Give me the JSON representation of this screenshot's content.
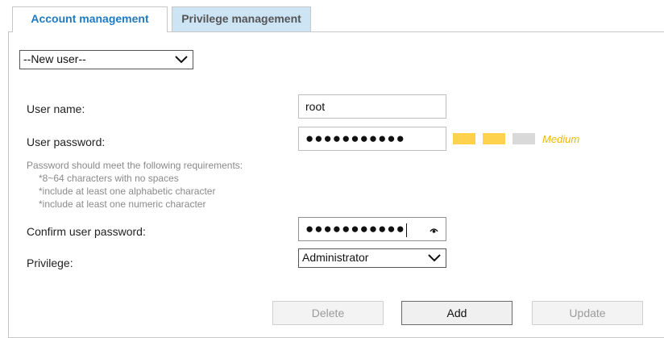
{
  "tabs": [
    {
      "label": "Account management",
      "active": true
    },
    {
      "label": "Privilege management",
      "active": false
    }
  ],
  "user_select": {
    "value": "--New user--"
  },
  "form": {
    "username_label": "User name:",
    "username_value": "root",
    "password_label": "User password:",
    "password_value": "●●●●●●●●●●●",
    "strength": {
      "level": 2,
      "max": 3,
      "text": "Medium",
      "color_on": "#ffd24d",
      "color_off": "#d9d9d9",
      "text_color": "#f2b705"
    },
    "requirements": [
      "Password should meet the following requirements:",
      "*8~64 characters with no spaces",
      "*include at least one alphabetic character",
      "*include at least one numeric character"
    ],
    "confirm_label": "Confirm user password:",
    "confirm_value": "●●●●●●●●●●●",
    "privilege_label": "Privilege:",
    "privilege_value": "Administrator"
  },
  "buttons": {
    "delete": "Delete",
    "add": "Add",
    "update": "Update"
  },
  "colors": {
    "tab_active_text": "#1f7ac0",
    "tab_inactive_bg": "#cce4f4"
  }
}
